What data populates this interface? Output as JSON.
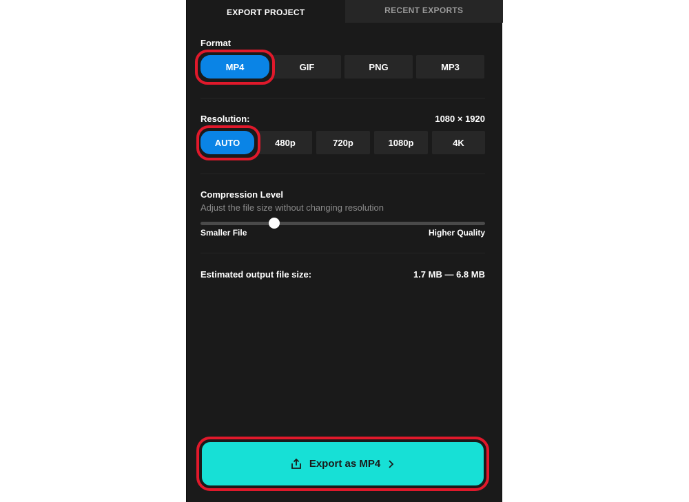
{
  "tabs": [
    {
      "label": "EXPORT PROJECT",
      "active": true
    },
    {
      "label": "RECENT EXPORTS",
      "active": false
    }
  ],
  "format": {
    "label": "Format",
    "options": [
      "MP4",
      "GIF",
      "PNG",
      "MP3"
    ],
    "selected": "MP4"
  },
  "resolution": {
    "label": "Resolution:",
    "value": "1080 × 1920",
    "options": [
      "AUTO",
      "480p",
      "720p",
      "1080p",
      "4K"
    ],
    "selected": "AUTO"
  },
  "compression": {
    "label": "Compression Level",
    "description": "Adjust the file size without changing resolution",
    "min_label": "Smaller File",
    "max_label": "Higher Quality",
    "level": 0.26
  },
  "estimate": {
    "label": "Estimated output file size:",
    "value": "1.7 MB — 6.8 MB"
  },
  "export_button": {
    "label": "Export as MP4",
    "icon": "share-upload-icon",
    "trailing_icon": "chevron-right-icon"
  },
  "colors": {
    "panel_bg": "#1a1a1a",
    "selected_blue": "#0a84e6",
    "export_cyan": "#17e0d6",
    "highlight_red": "#e0192b"
  }
}
